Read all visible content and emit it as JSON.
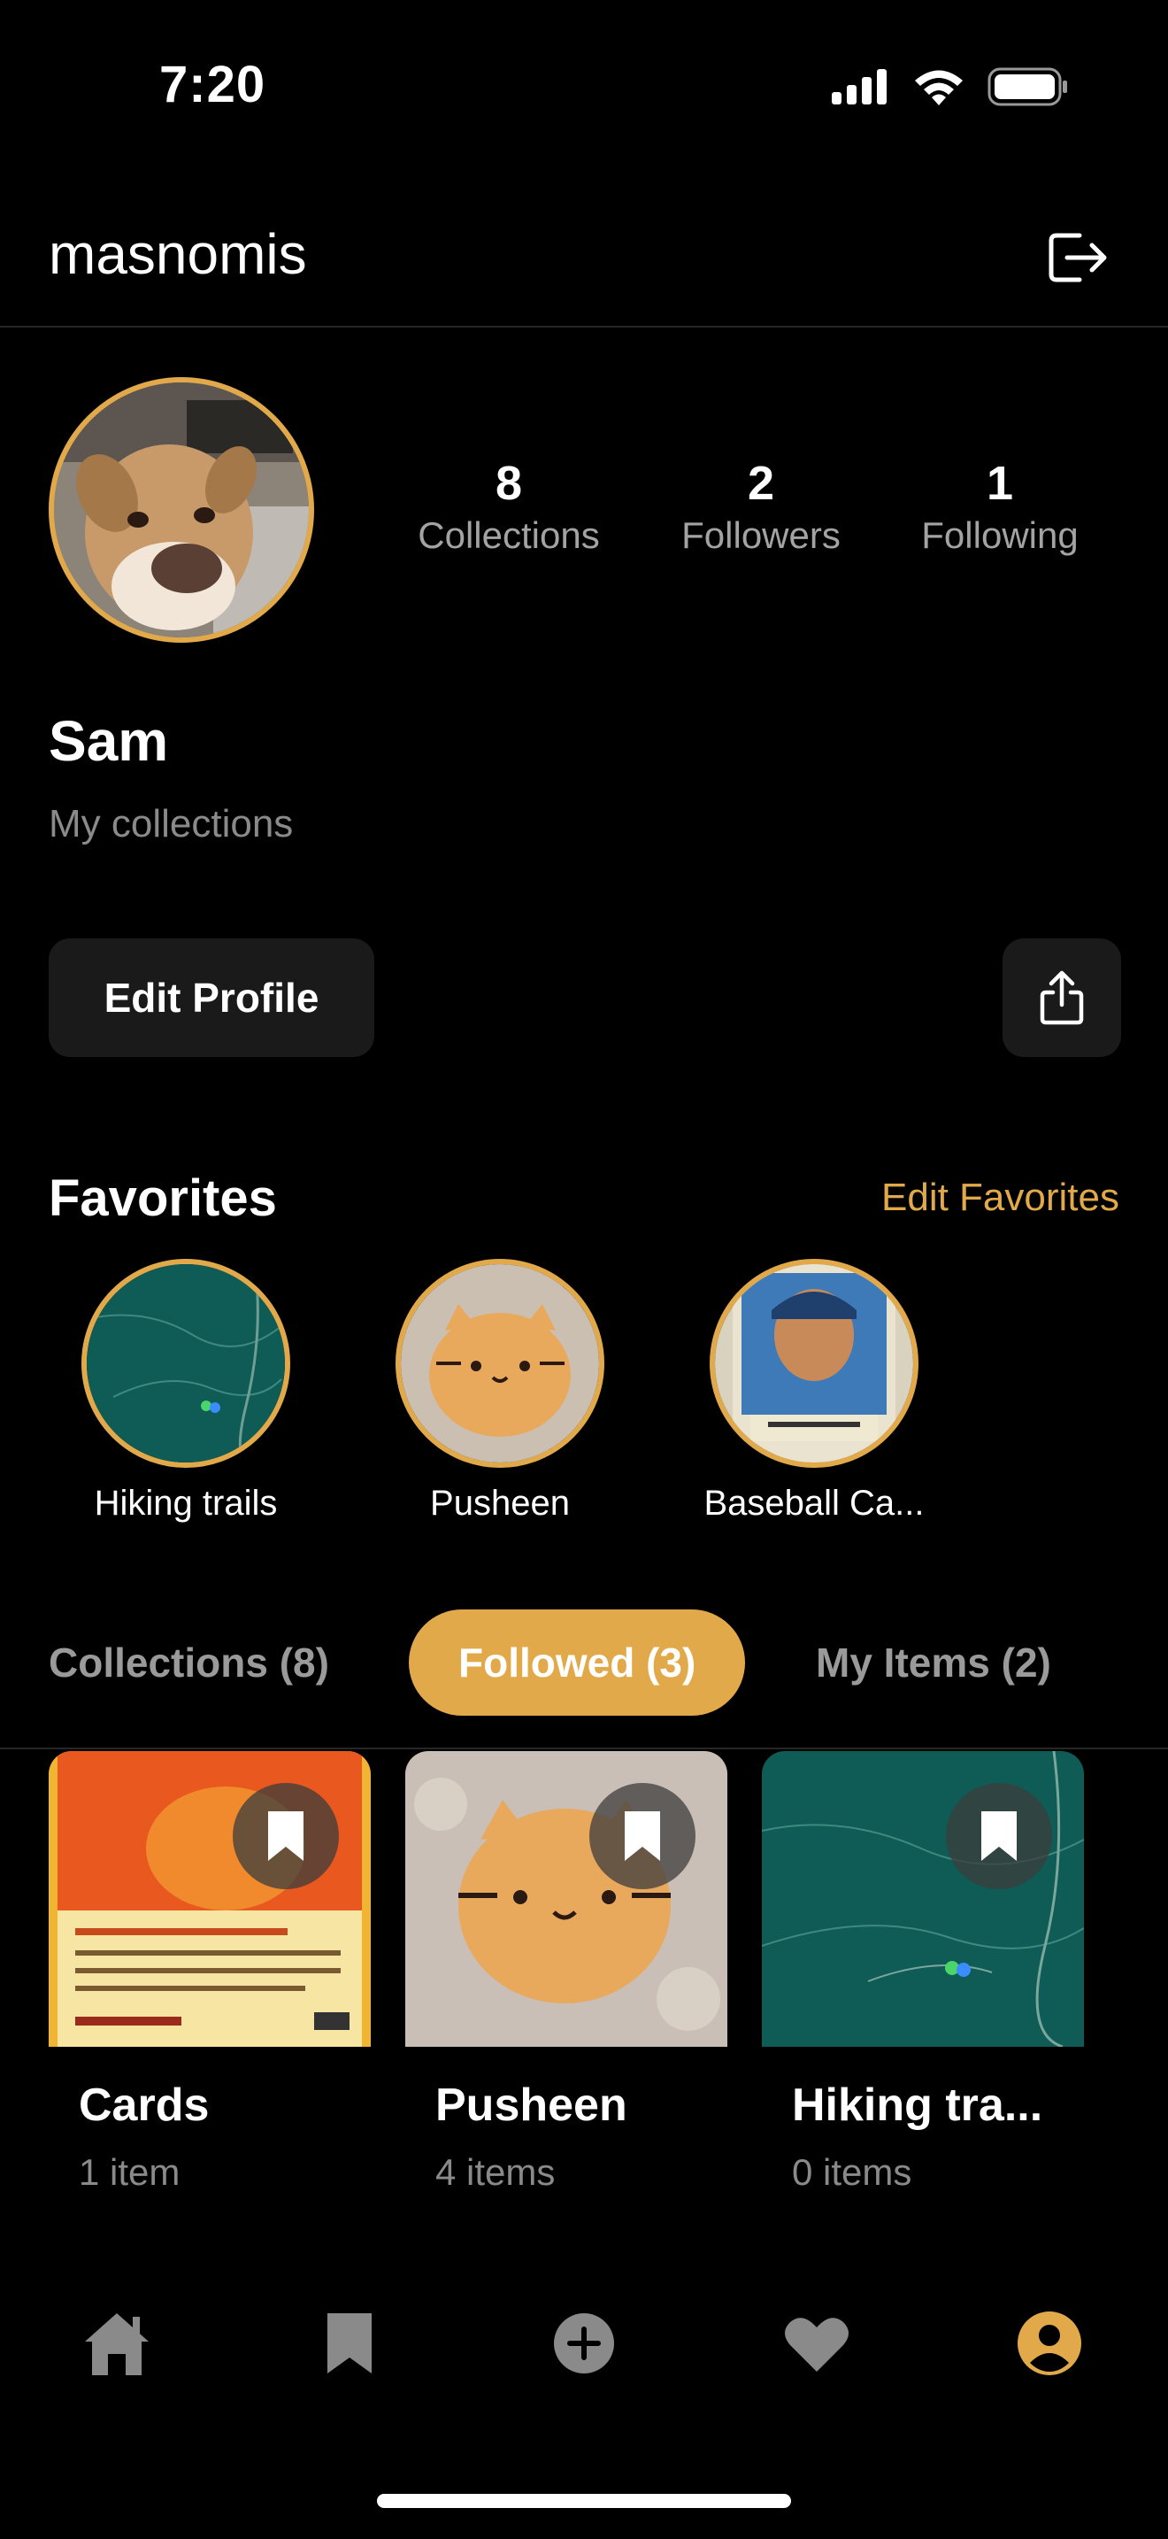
{
  "status_bar": {
    "time": "7:20"
  },
  "header": {
    "username": "masnomis",
    "logout_icon": "logout-icon"
  },
  "profile": {
    "avatar_alt": "avatar",
    "stats": [
      {
        "value": "8",
        "label": "Collections"
      },
      {
        "value": "2",
        "label": "Followers"
      },
      {
        "value": "1",
        "label": "Following"
      }
    ],
    "name": "Sam",
    "bio": "My collections",
    "edit_profile_label": "Edit Profile",
    "share_icon": "share-icon"
  },
  "favorites": {
    "title": "Favorites",
    "edit_label": "Edit Favorites",
    "items": [
      {
        "label": "Hiking trails"
      },
      {
        "label": "Pusheen"
      },
      {
        "label": "Baseball Ca..."
      }
    ]
  },
  "tabs": [
    {
      "label": "Collections (8)",
      "active": false
    },
    {
      "label": "Followed (3)",
      "active": true
    },
    {
      "label": "My Items (2)",
      "active": false
    }
  ],
  "collections": [
    {
      "title": "Cards",
      "count": "1 item"
    },
    {
      "title": "Pusheen",
      "count": "4 items"
    },
    {
      "title": "Hiking tra...",
      "count": "0 items"
    }
  ],
  "bottom_nav": {
    "items": [
      "home-icon",
      "bookmark-icon",
      "add-icon",
      "heart-icon",
      "profile-icon"
    ],
    "active": "profile-icon"
  },
  "colors": {
    "accent": "#e2a94a",
    "background": "#000000",
    "surface": "#1a1a1a",
    "muted": "#8a8a8a"
  }
}
